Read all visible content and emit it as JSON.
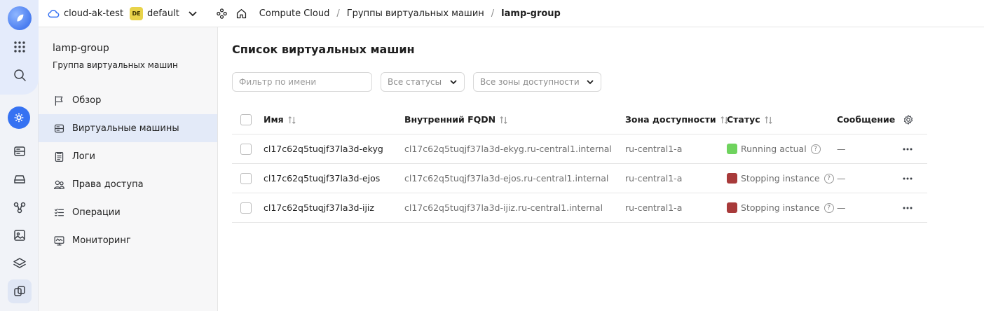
{
  "topbar": {
    "cloud_name": "cloud-ak-test",
    "folder_badge": "DE",
    "folder_name": "default",
    "breadcrumbs": [
      "Compute Cloud",
      "Группы виртуальных машин",
      "lamp-group"
    ]
  },
  "sidebar": {
    "title": "lamp-group",
    "subtitle": "Группа виртуальных машин",
    "items": [
      {
        "label": "Обзор",
        "icon": "flag-icon"
      },
      {
        "label": "Виртуальные машины",
        "icon": "server-icon"
      },
      {
        "label": "Логи",
        "icon": "log-icon"
      },
      {
        "label": "Права доступа",
        "icon": "users-icon"
      },
      {
        "label": "Операции",
        "icon": "operations-icon"
      },
      {
        "label": "Мониторинг",
        "icon": "monitoring-icon"
      }
    ],
    "active_index": 1
  },
  "main": {
    "title": "Список виртуальных машин",
    "filter_placeholder": "Фильтр по имени",
    "status_select": "Все статусы",
    "zone_select": "Все зоны доступности",
    "columns": [
      "Имя",
      "Внутренний FQDN",
      "Зона доступности",
      "Статус",
      "Сообщение"
    ],
    "rows": [
      {
        "name": "cl17c62q5tuqjf37la3d-ekyg",
        "fqdn": "cl17c62q5tuqjf37la3d-ekyg.ru-central1.internal",
        "zone": "ru-central1-a",
        "status": "Running actual",
        "message": "—"
      },
      {
        "name": "cl17c62q5tuqjf37la3d-ejos",
        "fqdn": "cl17c62q5tuqjf37la3d-ejos.ru-central1.internal",
        "zone": "ru-central1-a",
        "status": "Stopping instance",
        "message": "—"
      },
      {
        "name": "cl17c62q5tuqjf37la3d-ijiz",
        "fqdn": "cl17c62q5tuqjf37la3d-ijiz.ru-central1.internal",
        "zone": "ru-central1-a",
        "status": "Stopping instance",
        "message": "—"
      }
    ]
  },
  "colors": {
    "accent": "#3672f2",
    "status_running": "#6fd35e",
    "status_stopping": "#a83a3a",
    "active_bg": "#e3eaf8"
  }
}
